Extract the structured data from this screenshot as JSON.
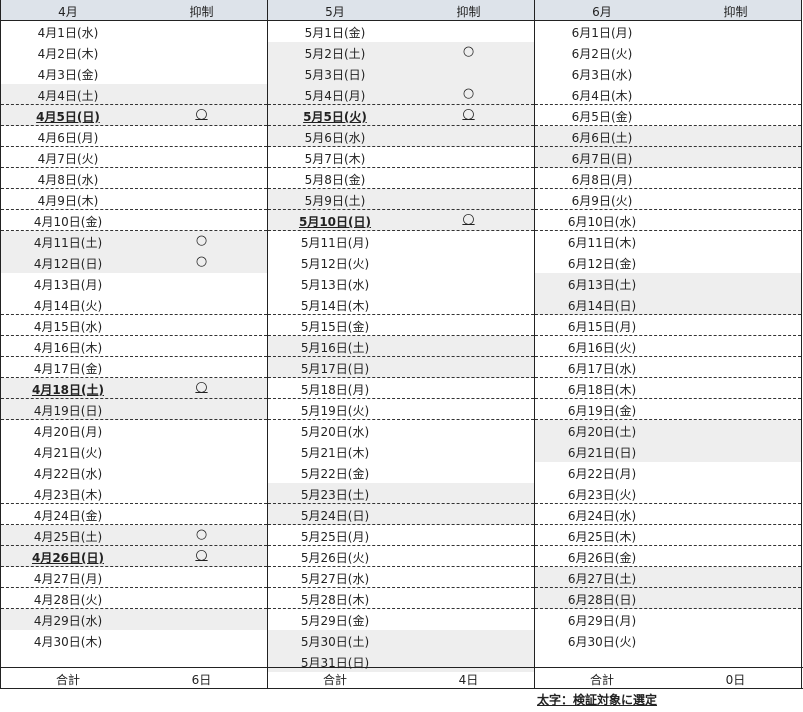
{
  "columns": [
    {
      "month_label": "4月",
      "mark_label": "抑制",
      "total_label": "合計",
      "total_value": "6日",
      "rows": [
        {
          "date": "4月1日(水)",
          "mark": "",
          "shade": false,
          "bold": false,
          "dash": false
        },
        {
          "date": "4月2日(木)",
          "mark": "",
          "shade": false,
          "bold": false,
          "dash": false
        },
        {
          "date": "4月3日(金)",
          "mark": "",
          "shade": false,
          "bold": false,
          "dash": false
        },
        {
          "date": "4月4日(土)",
          "mark": "",
          "shade": true,
          "bold": false,
          "dash": true
        },
        {
          "date": "4月5日(日)",
          "mark": "○",
          "shade": true,
          "bold": true,
          "dash": true
        },
        {
          "date": "4月6日(月)",
          "mark": "",
          "shade": false,
          "bold": false,
          "dash": true
        },
        {
          "date": "4月7日(火)",
          "mark": "",
          "shade": false,
          "bold": false,
          "dash": true
        },
        {
          "date": "4月8日(水)",
          "mark": "",
          "shade": false,
          "bold": false,
          "dash": true
        },
        {
          "date": "4月9日(木)",
          "mark": "",
          "shade": false,
          "bold": false,
          "dash": true
        },
        {
          "date": "4月10日(金)",
          "mark": "",
          "shade": false,
          "bold": false,
          "dash": true
        },
        {
          "date": "4月11日(土)",
          "mark": "○",
          "shade": true,
          "bold": false,
          "dash": false
        },
        {
          "date": "4月12日(日)",
          "mark": "○",
          "shade": true,
          "bold": false,
          "dash": false
        },
        {
          "date": "4月13日(月)",
          "mark": "",
          "shade": false,
          "bold": false,
          "dash": false
        },
        {
          "date": "4月14日(火)",
          "mark": "",
          "shade": false,
          "bold": false,
          "dash": true
        },
        {
          "date": "4月15日(水)",
          "mark": "",
          "shade": false,
          "bold": false,
          "dash": true
        },
        {
          "date": "4月16日(木)",
          "mark": "",
          "shade": false,
          "bold": false,
          "dash": true
        },
        {
          "date": "4月17日(金)",
          "mark": "",
          "shade": false,
          "bold": false,
          "dash": true
        },
        {
          "date": "4月18日(土)",
          "mark": "○",
          "shade": true,
          "bold": true,
          "dash": true
        },
        {
          "date": "4月19日(日)",
          "mark": "",
          "shade": true,
          "bold": false,
          "dash": true
        },
        {
          "date": "4月20日(月)",
          "mark": "",
          "shade": false,
          "bold": false,
          "dash": false
        },
        {
          "date": "4月21日(火)",
          "mark": "",
          "shade": false,
          "bold": false,
          "dash": false
        },
        {
          "date": "4月22日(水)",
          "mark": "",
          "shade": false,
          "bold": false,
          "dash": false
        },
        {
          "date": "4月23日(木)",
          "mark": "",
          "shade": false,
          "bold": false,
          "dash": true
        },
        {
          "date": "4月24日(金)",
          "mark": "",
          "shade": false,
          "bold": false,
          "dash": true
        },
        {
          "date": "4月25日(土)",
          "mark": "○",
          "shade": true,
          "bold": false,
          "dash": true
        },
        {
          "date": "4月26日(日)",
          "mark": "○",
          "shade": true,
          "bold": true,
          "dash": true
        },
        {
          "date": "4月27日(月)",
          "mark": "",
          "shade": false,
          "bold": false,
          "dash": true
        },
        {
          "date": "4月28日(火)",
          "mark": "",
          "shade": false,
          "bold": false,
          "dash": true
        },
        {
          "date": "4月29日(水)",
          "mark": "",
          "shade": true,
          "bold": false,
          "dash": false
        },
        {
          "date": "4月30日(木)",
          "mark": "",
          "shade": false,
          "bold": false,
          "dash": false
        },
        {
          "date": "",
          "mark": "",
          "shade": false,
          "bold": false,
          "dash": false
        }
      ]
    },
    {
      "month_label": "5月",
      "mark_label": "抑制",
      "total_label": "合計",
      "total_value": "4日",
      "rows": [
        {
          "date": "5月1日(金)",
          "mark": "",
          "shade": false,
          "bold": false,
          "dash": false
        },
        {
          "date": "5月2日(土)",
          "mark": "○",
          "shade": true,
          "bold": false,
          "dash": false
        },
        {
          "date": "5月3日(日)",
          "mark": "",
          "shade": true,
          "bold": false,
          "dash": false
        },
        {
          "date": "5月4日(月)",
          "mark": "○",
          "shade": true,
          "bold": false,
          "dash": true
        },
        {
          "date": "5月5日(火)",
          "mark": "○",
          "shade": true,
          "bold": true,
          "dash": true
        },
        {
          "date": "5月6日(水)",
          "mark": "",
          "shade": true,
          "bold": false,
          "dash": true
        },
        {
          "date": "5月7日(木)",
          "mark": "",
          "shade": false,
          "bold": false,
          "dash": true
        },
        {
          "date": "5月8日(金)",
          "mark": "",
          "shade": false,
          "bold": false,
          "dash": true
        },
        {
          "date": "5月9日(土)",
          "mark": "",
          "shade": true,
          "bold": false,
          "dash": true
        },
        {
          "date": "5月10日(日)",
          "mark": "○",
          "shade": true,
          "bold": true,
          "dash": true
        },
        {
          "date": "5月11日(月)",
          "mark": "",
          "shade": false,
          "bold": false,
          "dash": false
        },
        {
          "date": "5月12日(火)",
          "mark": "",
          "shade": false,
          "bold": false,
          "dash": false
        },
        {
          "date": "5月13日(水)",
          "mark": "",
          "shade": false,
          "bold": false,
          "dash": false
        },
        {
          "date": "5月14日(木)",
          "mark": "",
          "shade": false,
          "bold": false,
          "dash": true
        },
        {
          "date": "5月15日(金)",
          "mark": "",
          "shade": false,
          "bold": false,
          "dash": true
        },
        {
          "date": "5月16日(土)",
          "mark": "",
          "shade": true,
          "bold": false,
          "dash": true
        },
        {
          "date": "5月17日(日)",
          "mark": "",
          "shade": true,
          "bold": false,
          "dash": true
        },
        {
          "date": "5月18日(月)",
          "mark": "",
          "shade": false,
          "bold": false,
          "dash": true
        },
        {
          "date": "5月19日(火)",
          "mark": "",
          "shade": false,
          "bold": false,
          "dash": true
        },
        {
          "date": "5月20日(水)",
          "mark": "",
          "shade": false,
          "bold": false,
          "dash": false
        },
        {
          "date": "5月21日(木)",
          "mark": "",
          "shade": false,
          "bold": false,
          "dash": false
        },
        {
          "date": "5月22日(金)",
          "mark": "",
          "shade": false,
          "bold": false,
          "dash": false
        },
        {
          "date": "5月23日(土)",
          "mark": "",
          "shade": true,
          "bold": false,
          "dash": true
        },
        {
          "date": "5月24日(日)",
          "mark": "",
          "shade": true,
          "bold": false,
          "dash": true
        },
        {
          "date": "5月25日(月)",
          "mark": "",
          "shade": false,
          "bold": false,
          "dash": true
        },
        {
          "date": "5月26日(火)",
          "mark": "",
          "shade": false,
          "bold": false,
          "dash": true
        },
        {
          "date": "5月27日(水)",
          "mark": "",
          "shade": false,
          "bold": false,
          "dash": true
        },
        {
          "date": "5月28日(木)",
          "mark": "",
          "shade": false,
          "bold": false,
          "dash": true
        },
        {
          "date": "5月29日(金)",
          "mark": "",
          "shade": false,
          "bold": false,
          "dash": false
        },
        {
          "date": "5月30日(土)",
          "mark": "",
          "shade": true,
          "bold": false,
          "dash": false
        },
        {
          "date": "5月31日(日)",
          "mark": "",
          "shade": true,
          "bold": false,
          "dash": false
        }
      ]
    },
    {
      "month_label": "6月",
      "mark_label": "抑制",
      "total_label": "合計",
      "total_value": "0日",
      "rows": [
        {
          "date": "6月1日(月)",
          "mark": "",
          "shade": false,
          "bold": false,
          "dash": false
        },
        {
          "date": "6月2日(火)",
          "mark": "",
          "shade": false,
          "bold": false,
          "dash": false
        },
        {
          "date": "6月3日(水)",
          "mark": "",
          "shade": false,
          "bold": false,
          "dash": false
        },
        {
          "date": "6月4日(木)",
          "mark": "",
          "shade": false,
          "bold": false,
          "dash": true
        },
        {
          "date": "6月5日(金)",
          "mark": "",
          "shade": false,
          "bold": false,
          "dash": true
        },
        {
          "date": "6月6日(土)",
          "mark": "",
          "shade": true,
          "bold": false,
          "dash": true
        },
        {
          "date": "6月7日(日)",
          "mark": "",
          "shade": true,
          "bold": false,
          "dash": true
        },
        {
          "date": "6月8日(月)",
          "mark": "",
          "shade": false,
          "bold": false,
          "dash": true
        },
        {
          "date": "6月9日(火)",
          "mark": "",
          "shade": false,
          "bold": false,
          "dash": true
        },
        {
          "date": "6月10日(水)",
          "mark": "",
          "shade": false,
          "bold": false,
          "dash": true
        },
        {
          "date": "6月11日(木)",
          "mark": "",
          "shade": false,
          "bold": false,
          "dash": false
        },
        {
          "date": "6月12日(金)",
          "mark": "",
          "shade": false,
          "bold": false,
          "dash": false
        },
        {
          "date": "6月13日(土)",
          "mark": "",
          "shade": true,
          "bold": false,
          "dash": false
        },
        {
          "date": "6月14日(日)",
          "mark": "",
          "shade": true,
          "bold": false,
          "dash": true
        },
        {
          "date": "6月15日(月)",
          "mark": "",
          "shade": false,
          "bold": false,
          "dash": true
        },
        {
          "date": "6月16日(火)",
          "mark": "",
          "shade": false,
          "bold": false,
          "dash": true
        },
        {
          "date": "6月17日(水)",
          "mark": "",
          "shade": false,
          "bold": false,
          "dash": true
        },
        {
          "date": "6月18日(木)",
          "mark": "",
          "shade": false,
          "bold": false,
          "dash": true
        },
        {
          "date": "6月19日(金)",
          "mark": "",
          "shade": false,
          "bold": false,
          "dash": true
        },
        {
          "date": "6月20日(土)",
          "mark": "",
          "shade": true,
          "bold": false,
          "dash": false
        },
        {
          "date": "6月21日(日)",
          "mark": "",
          "shade": true,
          "bold": false,
          "dash": false
        },
        {
          "date": "6月22日(月)",
          "mark": "",
          "shade": false,
          "bold": false,
          "dash": false
        },
        {
          "date": "6月23日(火)",
          "mark": "",
          "shade": false,
          "bold": false,
          "dash": true
        },
        {
          "date": "6月24日(水)",
          "mark": "",
          "shade": false,
          "bold": false,
          "dash": true
        },
        {
          "date": "6月25日(木)",
          "mark": "",
          "shade": false,
          "bold": false,
          "dash": true
        },
        {
          "date": "6月26日(金)",
          "mark": "",
          "shade": false,
          "bold": false,
          "dash": true
        },
        {
          "date": "6月27日(土)",
          "mark": "",
          "shade": true,
          "bold": false,
          "dash": true
        },
        {
          "date": "6月28日(日)",
          "mark": "",
          "shade": true,
          "bold": false,
          "dash": true
        },
        {
          "date": "6月29日(月)",
          "mark": "",
          "shade": false,
          "bold": false,
          "dash": false
        },
        {
          "date": "6月30日(火)",
          "mark": "",
          "shade": false,
          "bold": false,
          "dash": false
        },
        {
          "date": "",
          "mark": "",
          "shade": false,
          "bold": false,
          "dash": false
        }
      ]
    }
  ],
  "legend": "太字：検証対象に選定",
  "colors": {
    "header_bg": "#dde3ea",
    "shade_bg": "#eeeeee"
  }
}
